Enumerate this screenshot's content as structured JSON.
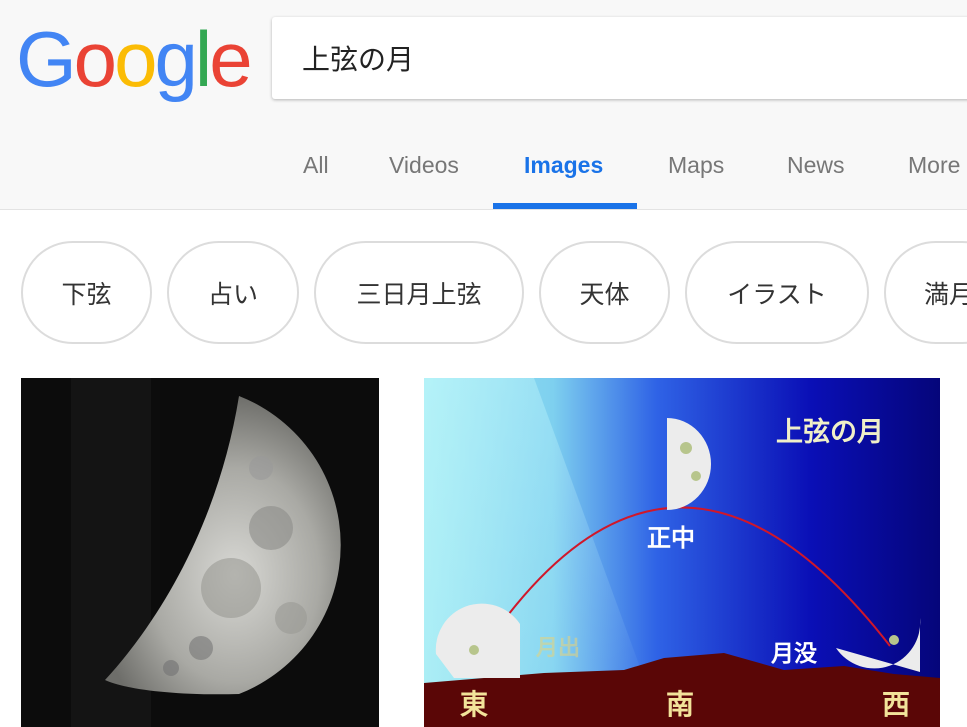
{
  "search": {
    "query": "上弦の月"
  },
  "logo": {
    "letters": [
      "G",
      "o",
      "o",
      "g",
      "l",
      "e"
    ]
  },
  "colors": {
    "blue": "#4285F4",
    "red": "#EA4335",
    "yellow": "#FBBC05",
    "green": "#34A853",
    "accent": "#1a73e8",
    "tab_text": "#777777"
  },
  "tabs": [
    {
      "label": "All"
    },
    {
      "label": "Videos"
    },
    {
      "label": "Images",
      "active": true
    },
    {
      "label": "Maps"
    },
    {
      "label": "News"
    },
    {
      "label": "More"
    }
  ],
  "chips": [
    "下弦",
    "占い",
    "三日月上弦",
    "天体",
    "イラスト",
    "満月"
  ],
  "results": {
    "moon_photo": {
      "icon": "half-moon-photo"
    },
    "diagram": {
      "title": "上弦の月",
      "labels": {
        "noon": "正中",
        "rise": "月出",
        "set": "月没",
        "east": "東",
        "south": "南",
        "west": "西"
      }
    }
  }
}
